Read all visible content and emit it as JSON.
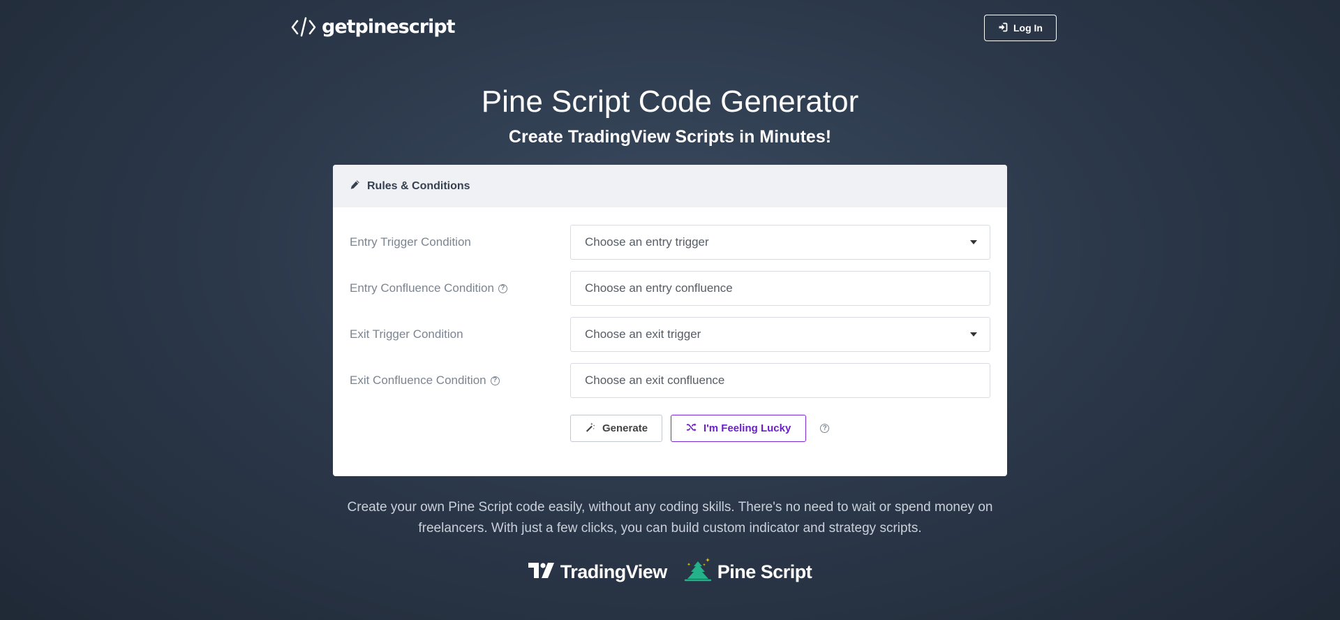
{
  "header": {
    "logo_text": "getpinescript",
    "login_label": "Log In"
  },
  "hero": {
    "title": "Pine Script Code Generator",
    "subtitle": "Create TradingView Scripts in Minutes!"
  },
  "card": {
    "header_title": "Rules & Conditions",
    "fields": [
      {
        "label": "Entry Trigger Condition",
        "placeholder": "Choose an entry trigger",
        "type": "select",
        "has_help": false
      },
      {
        "label": "Entry Confluence Condition",
        "placeholder": "Choose an entry confluence",
        "type": "input",
        "has_help": true
      },
      {
        "label": "Exit Trigger Condition",
        "placeholder": "Choose an exit trigger",
        "type": "select",
        "has_help": false
      },
      {
        "label": "Exit Confluence Condition",
        "placeholder": "Choose an exit confluence",
        "type": "input",
        "has_help": true
      }
    ],
    "generate_label": "Generate",
    "lucky_label": "I'm Feeling Lucky"
  },
  "description": "Create your own Pine Script code easily, without any coding skills. There's no need to wait or spend money on freelancers. With just a few clicks, you can build custom indicator and strategy scripts.",
  "brands": {
    "tradingview": "TradingView",
    "pinescript": "Pine Script"
  },
  "icons": {
    "logo": "code-slash-icon",
    "login": "sign-in-icon",
    "card_header": "pencil-icon",
    "generate": "magic-wand-icon",
    "lucky": "shuffle-icon",
    "help": "question-circle-icon",
    "tradingview": "tradingview-logo-icon",
    "pinescript": "pine-tree-icon"
  },
  "colors": {
    "accent_purple": "#6b1fc9",
    "pine_green": "#24b28a",
    "sparkle_yellow": "#f5c518"
  }
}
